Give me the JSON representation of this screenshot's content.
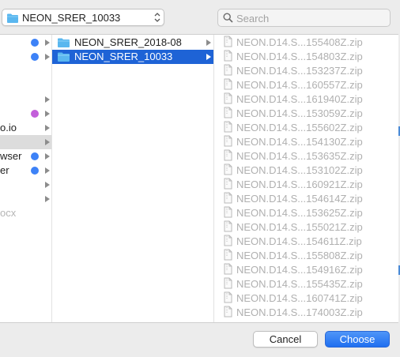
{
  "location": {
    "label": "NEON_SRER_10033"
  },
  "search": {
    "placeholder": "Search"
  },
  "sidebar": {
    "rows": [
      {
        "text": "",
        "dot": "blue",
        "arrow": true,
        "faded": false,
        "highlight": false
      },
      {
        "text": "",
        "dot": "blue",
        "arrow": true,
        "faded": false,
        "highlight": false
      },
      {
        "text": "",
        "dot": "",
        "arrow": false,
        "faded": false,
        "highlight": false
      },
      {
        "text": "",
        "dot": "",
        "arrow": false,
        "faded": false,
        "highlight": false
      },
      {
        "text": "",
        "dot": "",
        "arrow": true,
        "faded": false,
        "highlight": false
      },
      {
        "text": "",
        "dot": "purple",
        "arrow": true,
        "faded": false,
        "highlight": false
      },
      {
        "text": "o.io",
        "dot": "",
        "arrow": true,
        "faded": false,
        "highlight": false
      },
      {
        "text": "",
        "dot": "",
        "arrow": true,
        "faded": false,
        "highlight": true
      },
      {
        "text": "wser",
        "dot": "blue",
        "arrow": true,
        "faded": false,
        "highlight": false
      },
      {
        "text": "er",
        "dot": "blue",
        "arrow": true,
        "faded": false,
        "highlight": false
      },
      {
        "text": "",
        "dot": "",
        "arrow": true,
        "faded": false,
        "highlight": false
      },
      {
        "text": "",
        "dot": "",
        "arrow": true,
        "faded": false,
        "highlight": false
      },
      {
        "text": "ocx",
        "dot": "",
        "arrow": false,
        "faded": true,
        "highlight": false
      }
    ]
  },
  "folders": [
    {
      "name": "NEON_SRER_2018-08",
      "selected": false
    },
    {
      "name": "NEON_SRER_10033",
      "selected": true
    }
  ],
  "files": [
    "NEON.D14.S...155408Z.zip",
    "NEON.D14.S...154803Z.zip",
    "NEON.D14.S...153237Z.zip",
    "NEON.D14.S...160557Z.zip",
    "NEON.D14.S...161940Z.zip",
    "NEON.D14.S...153059Z.zip",
    "NEON.D14.S...155602Z.zip",
    "NEON.D14.S...154130Z.zip",
    "NEON.D14.S...153635Z.zip",
    "NEON.D14.S...153102Z.zip",
    "NEON.D14.S...160921Z.zip",
    "NEON.D14.S...154614Z.zip",
    "NEON.D14.S...153625Z.zip",
    "NEON.D14.S...155021Z.zip",
    "NEON.D14.S...154611Z.zip",
    "NEON.D14.S...155808Z.zip",
    "NEON.D14.S...154916Z.zip",
    "NEON.D14.S...155435Z.zip",
    "NEON.D14.S...160741Z.zip",
    "NEON.D14.S...174003Z.zip"
  ],
  "buttons": {
    "cancel": "Cancel",
    "choose": "Choose"
  },
  "colors": {
    "accent": "#1e63d6",
    "dot_blue": "#3d82f7",
    "dot_purple": "#c35fda",
    "folder": "#5ab7ef"
  }
}
